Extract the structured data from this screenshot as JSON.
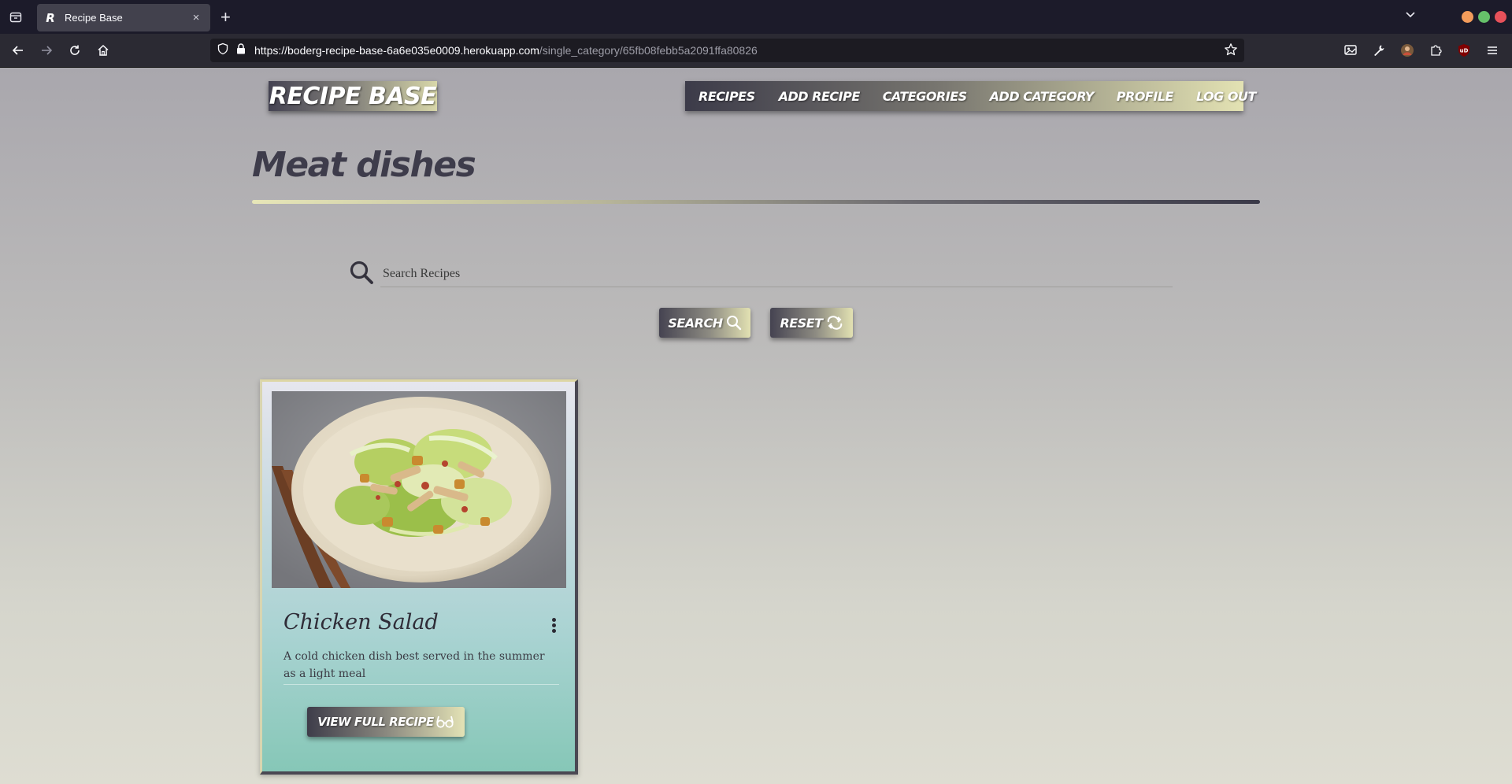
{
  "browser": {
    "tab_title": "Recipe Base",
    "favicon_letter": "R",
    "tab_close": "×",
    "new_tab": "+",
    "url_host": "https://boderg-recipe-base-6a6e035e0009.herokuapp.com",
    "url_path": "/single_category/65fb08febb5a2091ffa80826",
    "window_colors": [
      "#f39c5b",
      "#66c16a",
      "#e7515a"
    ]
  },
  "site": {
    "brand": "RECIPE BASE",
    "nav": [
      {
        "label": "RECIPES"
      },
      {
        "label": "ADD RECIPE"
      },
      {
        "label": "CATEGORIES"
      },
      {
        "label": "ADD CATEGORY"
      },
      {
        "label": "PROFILE"
      },
      {
        "label": "LOG OUT"
      }
    ]
  },
  "page": {
    "title": "Meat dishes"
  },
  "search": {
    "placeholder": "Search Recipes",
    "value": "",
    "search_label": "SEARCH",
    "reset_label": "RESET"
  },
  "recipes": [
    {
      "title": "Chicken Salad",
      "description": "A cold chicken dish best served in the summer as a light meal",
      "button_label": "VIEW FULL RECIPE"
    }
  ],
  "colors": {
    "title": "#3e3c4b",
    "accent_light": "#e3e2b3",
    "accent_dark": "#3c3b49",
    "card_teal": "#86c7b7"
  }
}
